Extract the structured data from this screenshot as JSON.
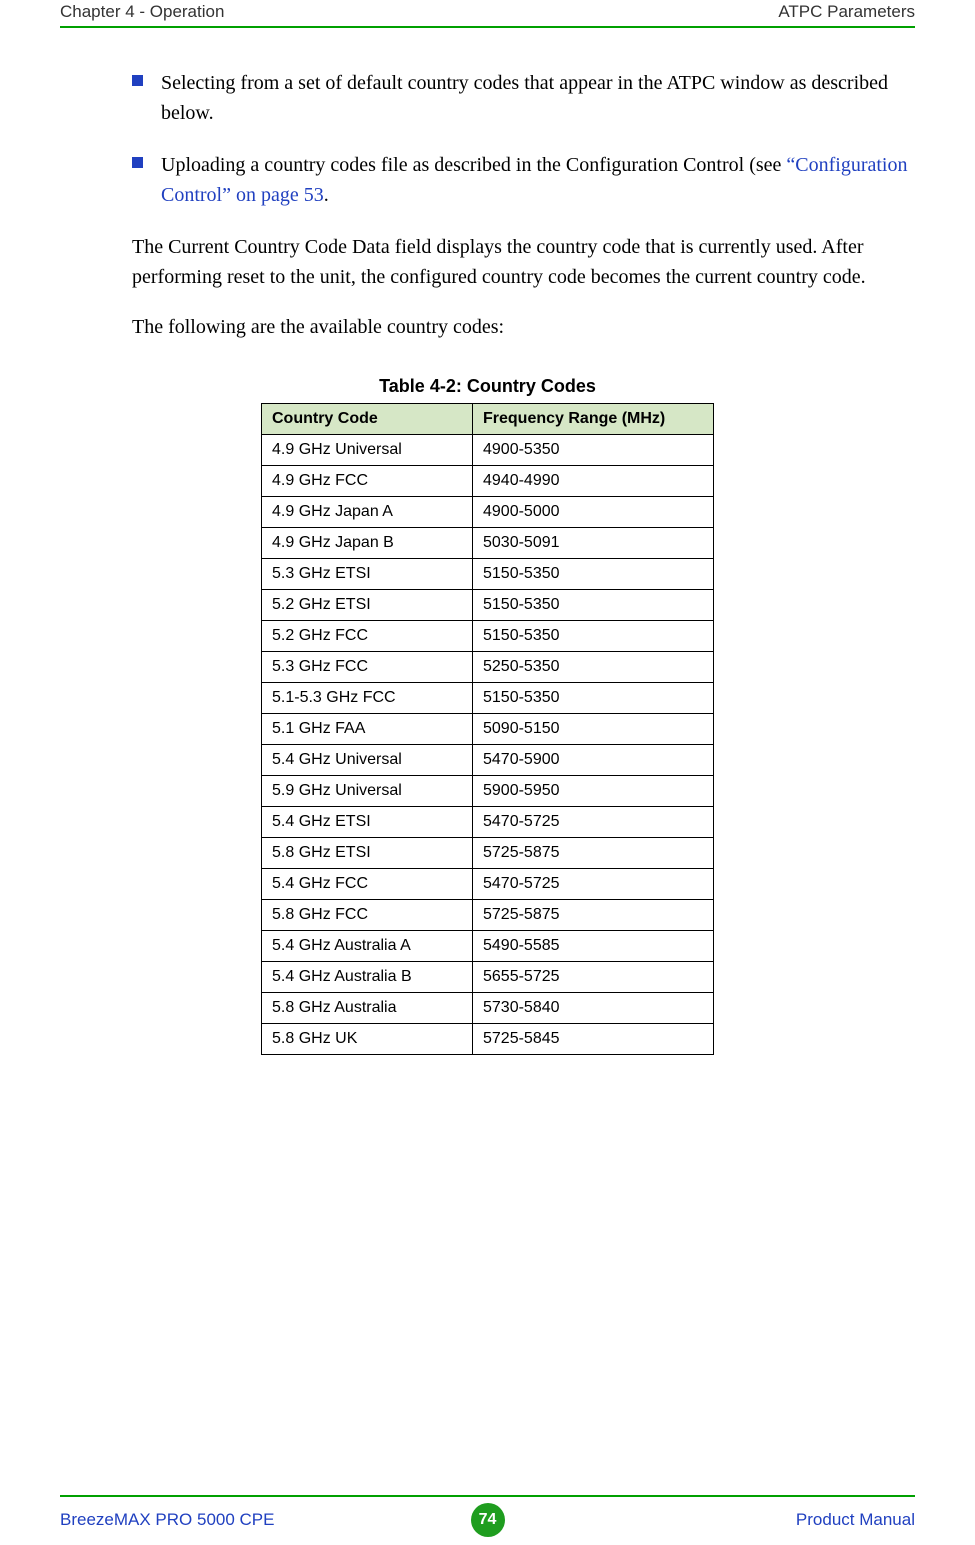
{
  "header": {
    "left": "Chapter 4 - Operation",
    "right": "ATPC Parameters"
  },
  "bullets": [
    {
      "pre": "Selecting from a set of default country codes that appear in the ATPC window as described below.",
      "link": "",
      "post": ""
    },
    {
      "pre": "Uploading a country codes file as described in the Configuration Control (see ",
      "link": "“Configuration Control” on page 53",
      "post": "."
    }
  ],
  "paragraphs": [
    "The Current Country Code Data field displays the country code that is currently used. After performing reset to the unit, the configured country code becomes the current country code.",
    "The following are the available country codes:"
  ],
  "table": {
    "caption": "Table 4-2: Country Codes",
    "headers": [
      "Country Code",
      "Frequency Range (MHz)"
    ],
    "rows": [
      [
        "4.9 GHz Universal",
        "4900-5350"
      ],
      [
        "4.9 GHz FCC",
        "4940-4990"
      ],
      [
        "4.9 GHz Japan A",
        "4900-5000"
      ],
      [
        "4.9 GHz Japan B",
        "5030-5091"
      ],
      [
        "5.3 GHz ETSI",
        "5150-5350"
      ],
      [
        "5.2 GHz ETSI",
        "5150-5350"
      ],
      [
        "5.2 GHz FCC",
        "5150-5350"
      ],
      [
        "5.3 GHz FCC",
        "5250-5350"
      ],
      [
        "5.1-5.3 GHz FCC",
        "5150-5350"
      ],
      [
        "5.1 GHz FAA",
        "5090-5150"
      ],
      [
        "5.4 GHz Universal",
        "5470-5900"
      ],
      [
        "5.9 GHz Universal",
        "5900-5950"
      ],
      [
        "5.4 GHz ETSI",
        "5470-5725"
      ],
      [
        "5.8 GHz ETSI",
        "5725-5875"
      ],
      [
        "5.4 GHz FCC",
        "5470-5725"
      ],
      [
        "5.8 GHz FCC",
        "5725-5875"
      ],
      [
        "5.4 GHz Australia A",
        "5490-5585"
      ],
      [
        "5.4 GHz Australia B",
        "5655-5725"
      ],
      [
        "5.8 GHz Australia",
        "5730-5840"
      ],
      [
        "5.8 GHz UK",
        "5725-5845"
      ]
    ]
  },
  "footer": {
    "left": "BreezeMAX PRO 5000 CPE",
    "page": "74",
    "right": "Product Manual"
  }
}
